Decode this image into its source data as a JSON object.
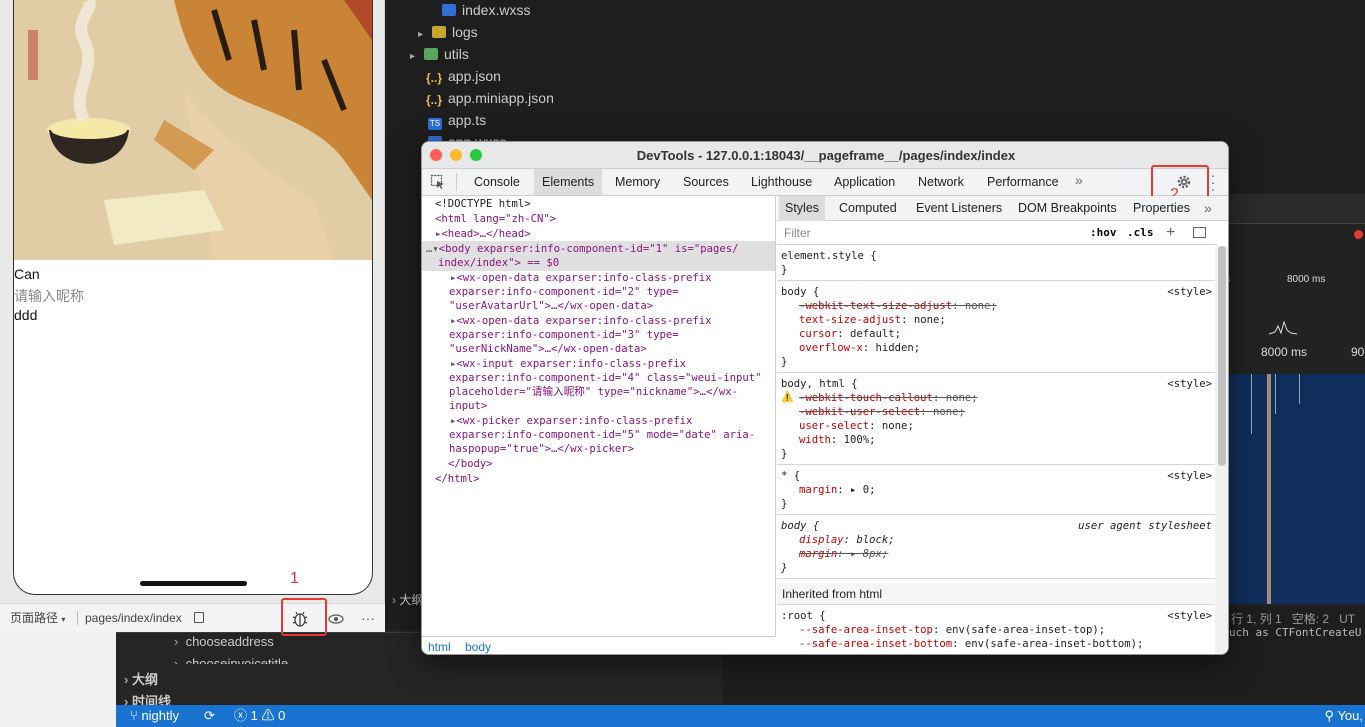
{
  "explorer": {
    "items": [
      {
        "label": "index.wxss",
        "kind": "css"
      },
      {
        "label": "logs",
        "kind": "folder"
      },
      {
        "label": "utils",
        "kind": "folder-green"
      },
      {
        "label": "app.json",
        "kind": "json"
      },
      {
        "label": "app.miniapp.json",
        "kind": "json"
      },
      {
        "label": "app.ts",
        "kind": "ts"
      },
      {
        "label": "app.wxss",
        "kind": "css"
      }
    ]
  },
  "simulator": {
    "texts": [
      "Can",
      "请输入昵称",
      "ddd"
    ],
    "footer": {
      "path_label": "页面路径",
      "path_value": "pages/index/index"
    },
    "annotation_1": "1"
  },
  "devtools": {
    "title": "DevTools - 127.0.0.1:18043/__pageframe__/pages/index/index",
    "tabs": [
      "Console",
      "Elements",
      "Memory",
      "Sources",
      "Lighthouse",
      "Application",
      "Network",
      "Performance"
    ],
    "active_tab": "Elements",
    "annotation_2": "2",
    "elements": {
      "doctype": "<!DOCTYPE html>",
      "html_open": "<html lang=\"zh-CN\">",
      "head": "<head>…</head>",
      "body_line1": "<body exparser:info-component-id=\"1\" is=\"pages/",
      "body_line2": "index/index\"> == $0",
      "node1_l1": "<wx-open-data exparser:info-class-prefix",
      "node1_l2": "exparser:info-component-id=\"2\" type=",
      "node1_l3": "\"userAvatarUrl\">…</wx-open-data>",
      "node2_l1": "<wx-open-data exparser:info-class-prefix",
      "node2_l2": "exparser:info-component-id=\"3\" type=",
      "node2_l3": "\"userNickName\">…</wx-open-data>",
      "node3_l1": "<wx-input exparser:info-class-prefix",
      "node3_l2": "exparser:info-component-id=\"4\" class=\"weui-input\"",
      "node3_l3": "placeholder=\"请输入昵称\" type=\"nickname\">…</wx-",
      "node3_l4": "input>",
      "node4_l1": "<wx-picker exparser:info-class-prefix",
      "node4_l2": "exparser:info-component-id=\"5\" mode=\"date\" aria-",
      "node4_l3": "haspopup=\"true\">…</wx-picker>",
      "body_close": "</body>",
      "html_close": "</html>"
    },
    "breadcrumbs": [
      "html",
      "body"
    ],
    "styles_tabs": [
      "Styles",
      "Computed",
      "Event Listeners",
      "DOM Breakpoints",
      "Properties"
    ],
    "filter_placeholder": "Filter",
    "hov": ":hov",
    "cls": ".cls",
    "rules": {
      "r1_sel": "element.style {",
      "close": "}",
      "r2_sel": "body {",
      "src_style": "<style>",
      "r2_p1": "-webkit-text-size-adjust: none;",
      "r2_p2": "text-size-adjust: none;",
      "r2_p3": "cursor: default;",
      "r2_p4": "overflow-x: hidden;",
      "r3_sel": "body, html {",
      "r3_p1": "-webkit-touch-callout: none;",
      "r3_p2": "-webkit-user-select: none;",
      "r3_p3": "user-select: none;",
      "r3_p4": "width: 100%;",
      "r4_sel": "* {",
      "r4_p1": "margin: ▸ 0;",
      "r5_sel": "body {",
      "r5_src": "user agent stylesheet",
      "r5_p1": "display: block;",
      "r5_p2": "margin: ▸ 8px;",
      "inherited": "Inherited from html",
      "r6_sel": ":root {",
      "r6_p1": "--safe-area-inset-top: env(safe-area-inset-top);",
      "r6_p2": "--safe-area-inset-bottom: env(safe-area-inset-bottom);"
    }
  },
  "timeline": {
    "label_8000_a": "8000 ms",
    "label_8000_b": "8000 ms",
    "label_90": "90"
  },
  "editor_status": {
    "position": "行 1, 列 1",
    "spaces": "空格: 2",
    "encoding": "UT",
    "hint": "uch as CTFontCreateU"
  },
  "lower_panel": {
    "items": [
      "chooseaddress",
      "chooseinvoicetitle",
      "大纲",
      "时间线"
    ],
    "left_label": "大纲"
  },
  "statusbar": {
    "branch": "nightly",
    "errors": "1",
    "warnings": "0",
    "right": "You,"
  }
}
